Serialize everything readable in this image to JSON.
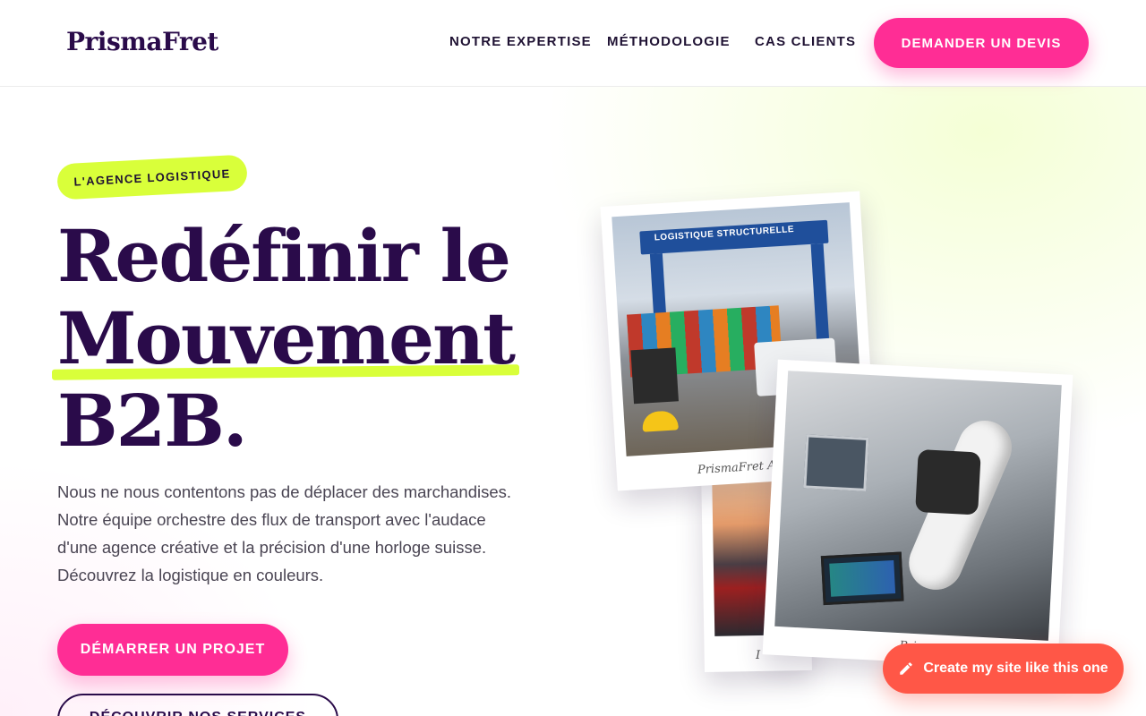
{
  "header": {
    "logo": "PrismaFret",
    "nav": [
      "NOTRE EXPERTISE",
      "MÉTHODOLOGIE",
      "CAS CLIENTS"
    ],
    "cta": "DEMANDER UN DEVIS"
  },
  "hero": {
    "badge": "L'AGENCE LOGISTIQUE",
    "title_line1": "Redéfinir le",
    "title_line2": "Mouvement",
    "title_line3": "B2B.",
    "description": "Nous ne nous contentons pas de déplacer des marchandises. Notre équipe orchestre des flux de transport avec l'audace d'une agence créative et la précision d'une horloge suisse. Découvrez la logistique en couleurs.",
    "primary_button": "DÉMARRER UN PROJET",
    "secondary_button": "DÉCOUVRIR NOS SERVICES"
  },
  "gallery": {
    "photo1_sign": "LOGISTIQUE STRUCTURELLE",
    "photo1_caption": "PrismaFret Arch",
    "photo2_caption": "Pris",
    "back_caption": "I"
  },
  "fab": {
    "label": "Create my site like this one",
    "icon": "pencil-icon"
  },
  "colors": {
    "primary": "#2a0b4a",
    "accent_pink": "#ff2d95",
    "accent_lime": "#d9ff3a",
    "fab": "#ff5747"
  }
}
